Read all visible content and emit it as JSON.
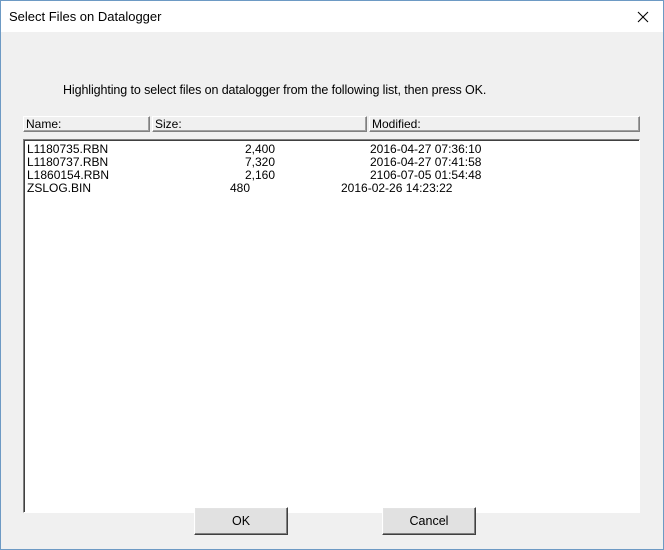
{
  "window": {
    "title": "Select Files on Datalogger"
  },
  "instruction": "Highlighting to select files on datalogger from the following list, then press OK.",
  "columns": {
    "name": "Name:",
    "size": "Size:",
    "modified": "Modified:"
  },
  "files": [
    {
      "name": "L1180735.RBN",
      "size": "2,400",
      "modified": "2016-04-27 07:36:10"
    },
    {
      "name": "L1180737.RBN",
      "size": "7,320",
      "modified": "2016-04-27 07:41:58"
    },
    {
      "name": "L1860154.RBN",
      "size": "2,160",
      "modified": "2106-07-05 01:54:48"
    },
    {
      "name": "ZSLOG.BIN",
      "size": "480",
      "modified": "2016-02-26 14:23:22"
    }
  ],
  "buttons": {
    "ok": "OK",
    "cancel": "Cancel"
  },
  "icons": {
    "close": "close-icon"
  }
}
